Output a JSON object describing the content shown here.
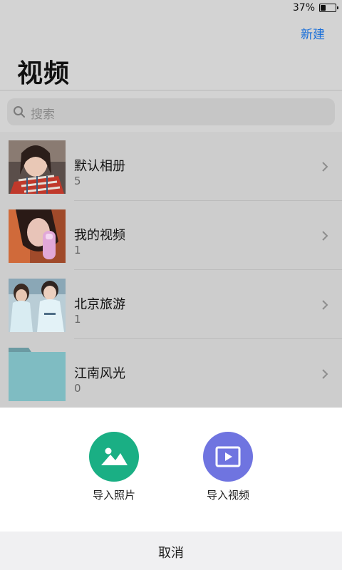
{
  "status_bar": {
    "battery_percent": "37%",
    "battery_level": 0.37
  },
  "header": {
    "new_button": "新建",
    "title": "视频"
  },
  "search": {
    "placeholder": "搜索"
  },
  "albums": [
    {
      "name": "默认相册",
      "count": "5"
    },
    {
      "name": "我的视频",
      "count": "1"
    },
    {
      "name": "北京旅游",
      "count": "1"
    },
    {
      "name": "江南风光",
      "count": "0"
    }
  ],
  "action_sheet": {
    "import_photo_label": "导入照片",
    "import_video_label": "导入视频",
    "cancel_label": "取消"
  },
  "colors": {
    "link_blue": "#1a6fd9",
    "photo_green": "#1aaf84",
    "video_purple": "#6f74e0",
    "folder_teal": "#7fbcc2"
  }
}
